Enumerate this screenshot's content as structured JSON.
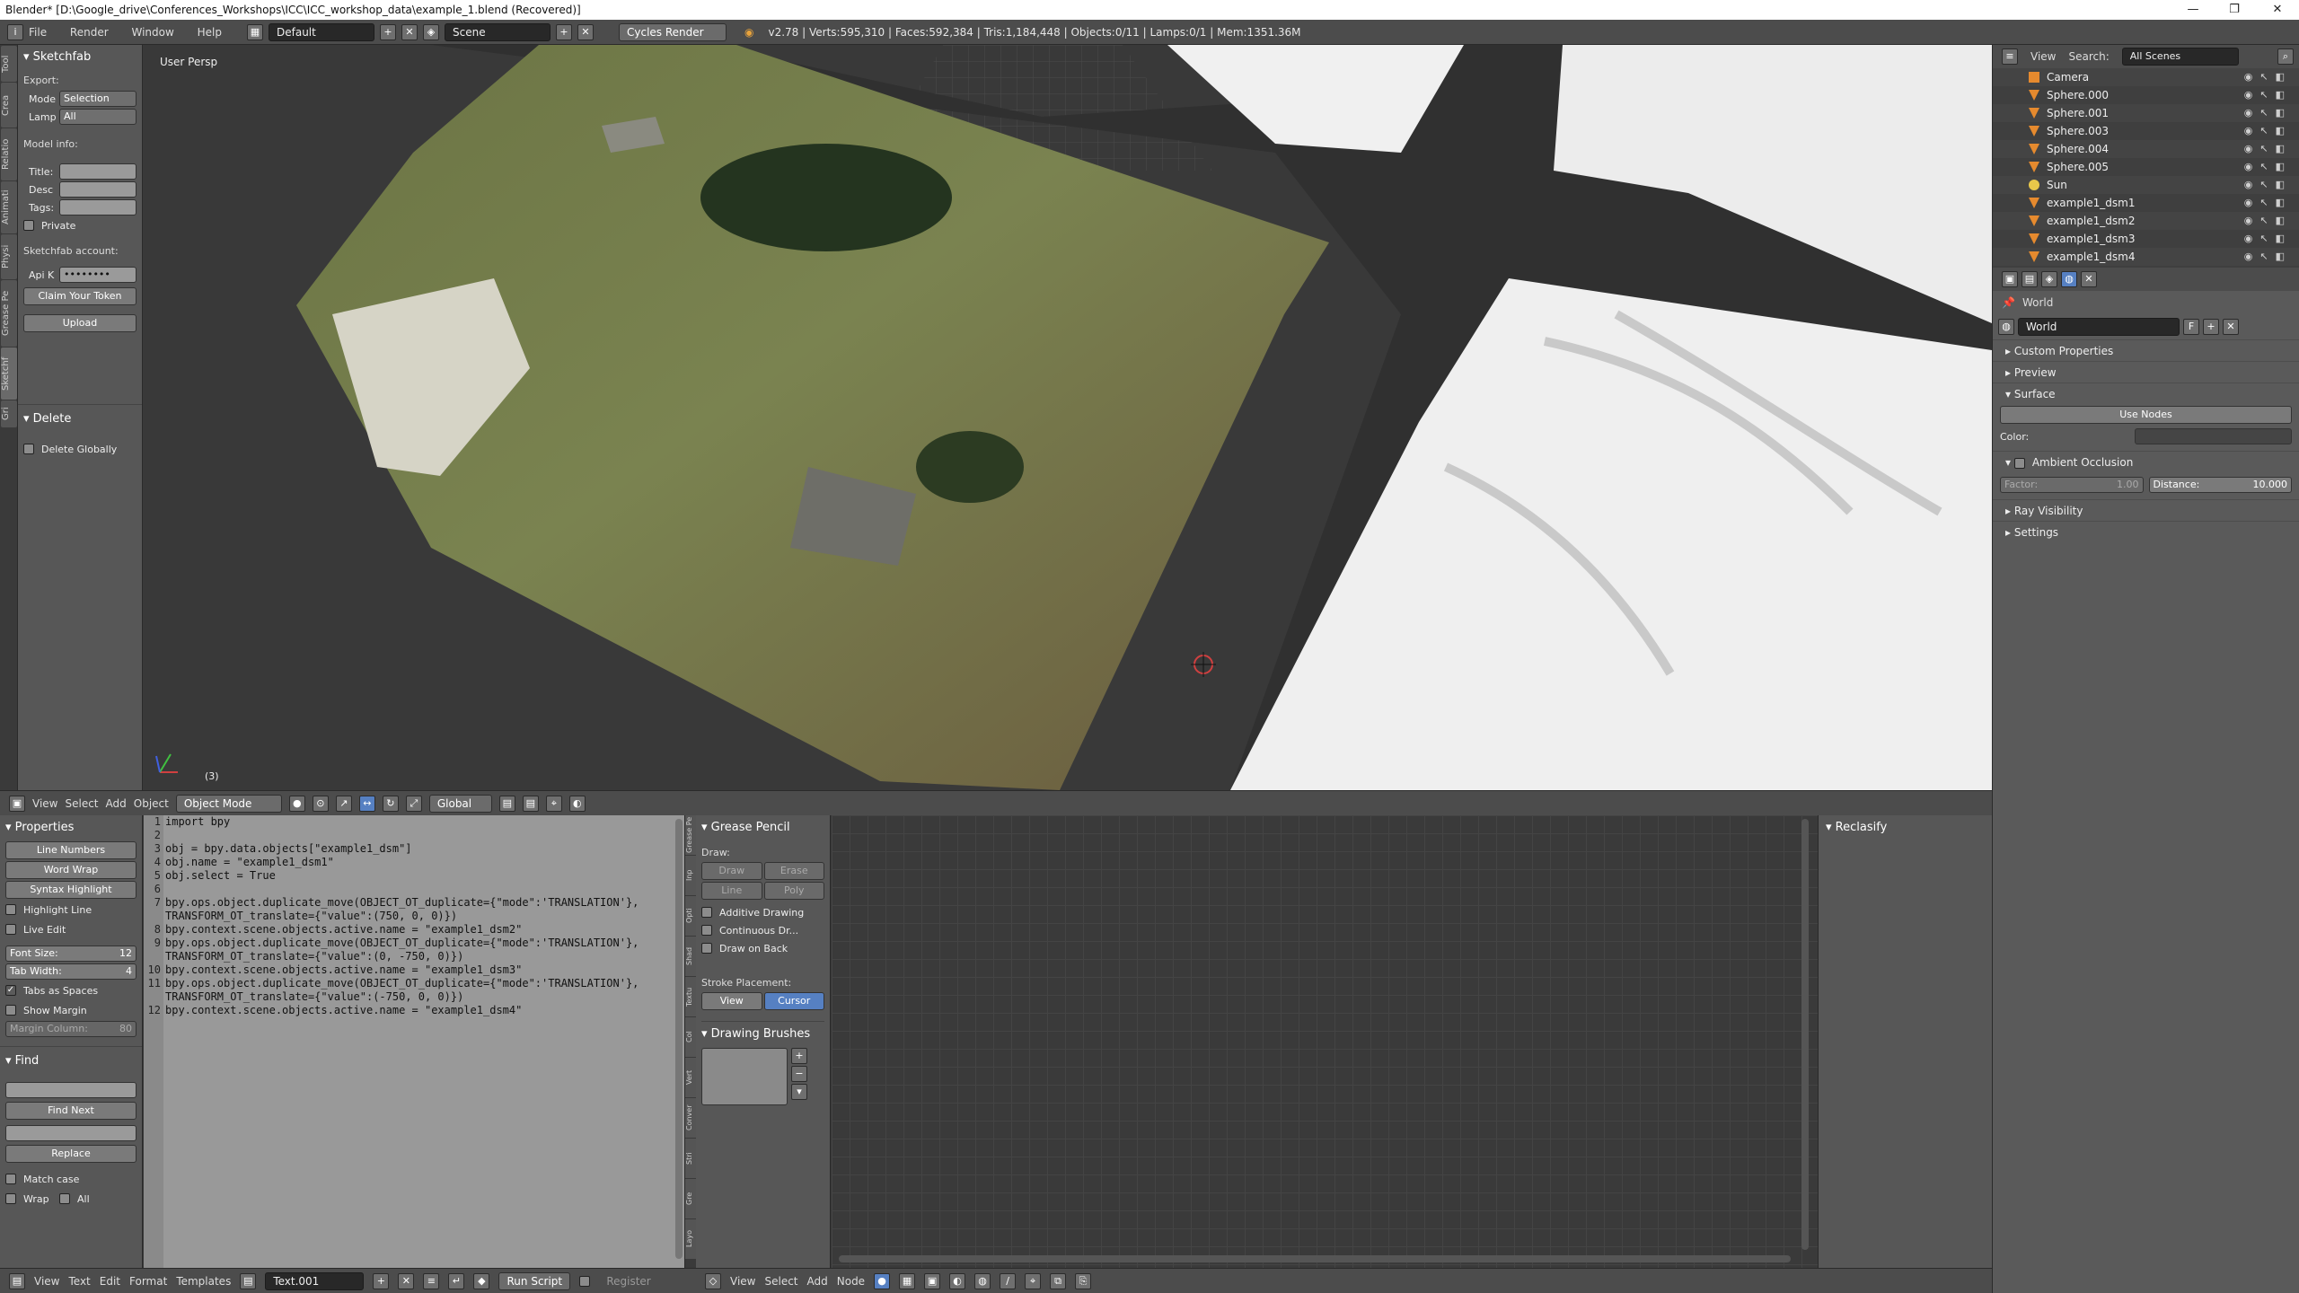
{
  "window": {
    "title": "Blender* [D:\\Google_drive\\Conferences_Workshops\\ICC\\ICC_workshop_data\\example_1.blend (Recovered)]",
    "controls": [
      "—",
      "❐",
      "✕"
    ]
  },
  "infobar": {
    "menus": [
      "File",
      "Render",
      "Window",
      "Help"
    ],
    "layout": "Default",
    "scene": "Scene",
    "engine": "Cycles Render",
    "stats": "v2.78 | Verts:595,310 | Faces:592,384 | Tris:1,184,448 | Objects:0/11 | Lamps:0/1 | Mem:1351.36M"
  },
  "left_tabs": [
    "Tool",
    "Crea",
    "Relatio",
    "Animati",
    "Physi",
    "Grease Pe",
    "Sketchf",
    "Gri"
  ],
  "sketchfab": {
    "header": "Sketchfab",
    "export_label": "Export:",
    "mode_label": "Mode",
    "mode_value": "Selection",
    "lamp_label": "Lamp",
    "lamp_value": "All",
    "model_info": "Model info:",
    "title_label": "Title:",
    "desc_label": "Desc",
    "tags_label": "Tags:",
    "private_label": "Private",
    "account_label": "Sketchfab account:",
    "api_label": "Api K",
    "api_value": "••••••••",
    "claim_token": "Claim Your Token",
    "upload": "Upload",
    "delete_header": "Delete",
    "delete_globally": "Delete Globally"
  },
  "viewport": {
    "label": "User Persp",
    "frame": "(3)"
  },
  "view3d_header": {
    "menus": [
      "View",
      "Select",
      "Add",
      "Object"
    ],
    "mode": "Object Mode",
    "orientation": "Global"
  },
  "outliner": {
    "header": [
      "View",
      "Search:"
    ],
    "scene_filter": "All Scenes",
    "items": [
      {
        "name": "Camera",
        "icon": "camera-icon"
      },
      {
        "name": "Sphere.000",
        "icon": "mesh-icon"
      },
      {
        "name": "Sphere.001",
        "icon": "mesh-icon"
      },
      {
        "name": "Sphere.003",
        "icon": "mesh-icon"
      },
      {
        "name": "Sphere.004",
        "icon": "mesh-icon"
      },
      {
        "name": "Sphere.005",
        "icon": "mesh-icon"
      },
      {
        "name": "Sun",
        "icon": "lamp-icon"
      },
      {
        "name": "example1_dsm1",
        "icon": "mesh-icon"
      },
      {
        "name": "example1_dsm2",
        "icon": "mesh-icon"
      },
      {
        "name": "example1_dsm3",
        "icon": "mesh-icon"
      },
      {
        "name": "example1_dsm4",
        "icon": "mesh-icon"
      }
    ]
  },
  "properties": {
    "breadcrumb": "World",
    "world_name": "World",
    "world_f": "F",
    "sections": [
      "Custom Properties",
      "Preview",
      "Surface"
    ],
    "use_nodes": "Use Nodes",
    "color_label": "Color:",
    "ambient_occlusion": "Ambient Occlusion",
    "factor_label": "Factor:",
    "factor_value": "1.00",
    "distance_label": "Distance:",
    "distance_value": "10.000",
    "more_sections": [
      "Ray Visibility",
      "Settings"
    ]
  },
  "text_props": {
    "header": "Properties",
    "line_numbers": "Line Numbers",
    "word_wrap": "Word Wrap",
    "syntax_highlight": "Syntax Highlight",
    "highlight_line": "Highlight Line",
    "live_edit": "Live Edit",
    "font_size_label": "Font Size:",
    "font_size": "12",
    "tab_width_label": "Tab Width:",
    "tab_width": "4",
    "tabs_as_spaces": "Tabs as Spaces",
    "show_margin": "Show Margin",
    "margin_column_label": "Margin Column:",
    "margin_column": "80",
    "find_header": "Find",
    "find_next": "Find Next",
    "replace": "Replace",
    "match_case": "Match case",
    "wrap": "Wrap",
    "all": "All"
  },
  "code": {
    "line_numbers": [
      "1",
      "2",
      "3",
      "4",
      "5",
      "6",
      "7",
      "",
      "8",
      "9",
      "",
      "10",
      "11",
      "",
      "12"
    ],
    "lines": [
      "import bpy",
      "",
      "obj = bpy.data.objects[\"example1_dsm\"]",
      "obj.name = \"example1_dsm1\"",
      "obj.select = True",
      "",
      "bpy.ops.object.duplicate_move(OBJECT_OT_duplicate={\"mode\":'TRANSLATION'},",
      "TRANSFORM_OT_translate={\"value\":(750, 0, 0)})",
      "bpy.context.scene.objects.active.name = \"example1_dsm2\"",
      "bpy.ops.object.duplicate_move(OBJECT_OT_duplicate={\"mode\":'TRANSLATION'},",
      "TRANSFORM_OT_translate={\"value\":(0, -750, 0)})",
      "bpy.context.scene.objects.active.name = \"example1_dsm3\"",
      "bpy.ops.object.duplicate_move(OBJECT_OT_duplicate={\"mode\":'TRANSLATION'},",
      "TRANSFORM_OT_translate={\"value\":(-750, 0, 0)})",
      "bpy.context.scene.objects.active.name = \"example1_dsm4\""
    ]
  },
  "grease": {
    "tabs": [
      "Grease Pe",
      "Inp",
      "Opti",
      "Shad",
      "Textu",
      "Col",
      "Vert",
      "Conver",
      "Stri",
      "Gre",
      "Layo"
    ],
    "header": "Grease Pencil",
    "draw_label": "Draw:",
    "draw": "Draw",
    "erase": "Erase",
    "line": "Line",
    "poly": "Poly",
    "additive": "Additive Drawing",
    "continuous": "Continuous Dr...",
    "draw_on_back": "Draw on Back",
    "stroke_placement": "Stroke Placement:",
    "view": "View",
    "cursor": "Cursor",
    "brushes": "Drawing Brushes"
  },
  "reclassify": {
    "header": "Reclasify"
  },
  "text_header": {
    "menus": [
      "View",
      "Text",
      "Edit",
      "Format",
      "Templates"
    ],
    "text_name": "Text.001",
    "run_script": "Run Script",
    "register": "Register"
  },
  "node_header": {
    "menus": [
      "View",
      "Select",
      "Add",
      "Node"
    ]
  },
  "colors": {
    "accent_blue": "#5680c2",
    "mesh_orange": "#e68a2e",
    "code_string": "#8b1a1a",
    "code_number": "#2a3f8f"
  }
}
